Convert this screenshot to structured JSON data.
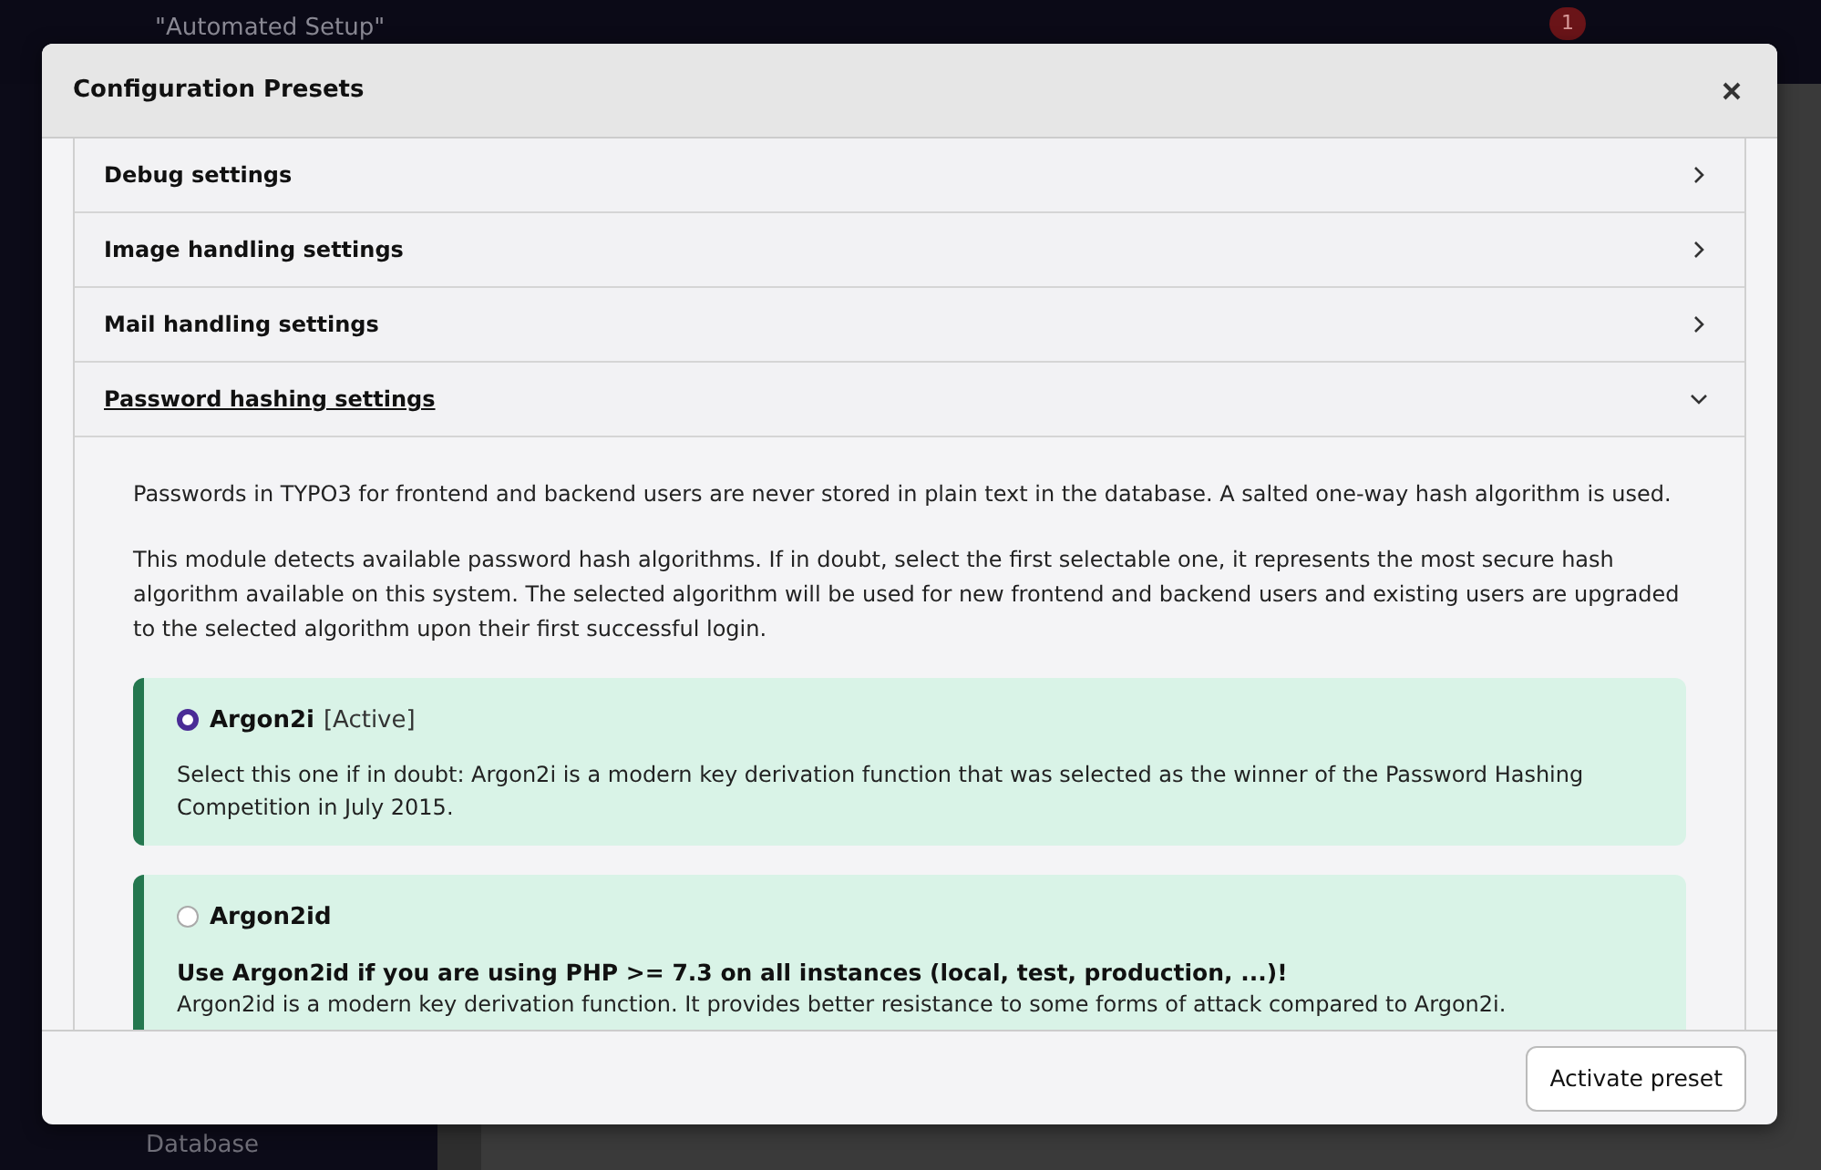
{
  "background": {
    "site_title": "\"Automated Setup\"",
    "notification_count": "1",
    "sidebar_items": [
      "Database"
    ]
  },
  "modal": {
    "title": "Configuration Presets",
    "sections": [
      {
        "title": "Debug settings",
        "expanded": false
      },
      {
        "title": "Image handling settings",
        "expanded": false
      },
      {
        "title": "Mail handling settings",
        "expanded": false
      },
      {
        "title": "Password hashing settings",
        "expanded": true
      }
    ],
    "intro": [
      "Passwords in TYPO3 for frontend and backend users are never stored in plain text in the database. A salted one-way hash algorithm is used.",
      "This module detects available password hash algorithms. If in doubt, select the first selectable one, it represents the most secure hash algorithm available on this system. The selected algorithm will be used for new frontend and backend users and existing users are upgraded to the selected algorithm upon their first successful login."
    ],
    "options": [
      {
        "name": "Argon2i",
        "tag": "[Active]",
        "selected": true,
        "description": "Select this one if in doubt: Argon2i is a modern key derivation function that was selected as the winner of the Password Hashing Competition in July 2015."
      },
      {
        "name": "Argon2id",
        "selected": false,
        "warning": "Use Argon2id if you are using PHP >= 7.3 on all instances (local, test, production, ...)!",
        "description": "Argon2id is a modern key derivation function. It provides better resistance to some forms of attack compared to Argon2i."
      }
    ],
    "button": "Activate preset"
  }
}
